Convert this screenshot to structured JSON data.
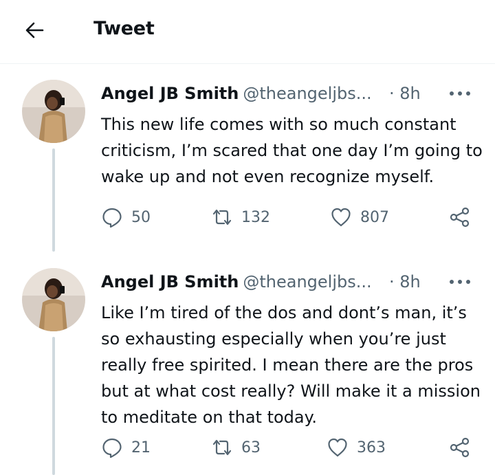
{
  "header": {
    "title": "Tweet"
  },
  "tweets": [
    {
      "name": "Angel JB Smith",
      "handle": "@theangeljbs...",
      "time": "· 8h",
      "text": "This new life comes with so much constant criticism, I’m scared that one day I’m going to wake up and not even recognize myself.",
      "replies": "50",
      "retweets": "132",
      "likes": "807"
    },
    {
      "name": "Angel JB Smith",
      "handle": "@theangeljbs...",
      "time": "· 8h",
      "text": "Like I’m tired of the dos and dont’s man, it’s so exhausting especially when you’re just really free spirited. I mean there are the pros but at what cost really? Will make it a mission to meditate on that today.",
      "replies": "21",
      "retweets": "63",
      "likes": "363"
    }
  ],
  "icons": {
    "back": "arrow-left-icon",
    "more": "more-horizontal-icon",
    "reply": "reply-bubble-icon",
    "retweet": "retweet-icon",
    "like": "heart-icon",
    "share": "share-icon"
  },
  "colors": {
    "text": "#0f1419",
    "secondary": "#536471",
    "thread_line": "#cfd9de"
  }
}
